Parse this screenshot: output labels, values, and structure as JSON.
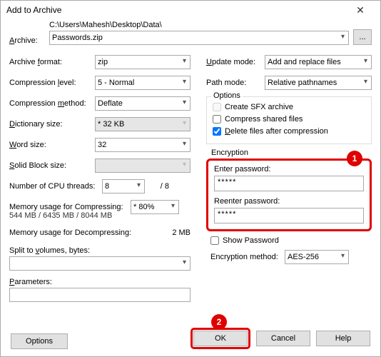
{
  "window": {
    "title": "Add to Archive",
    "close": "✕"
  },
  "top": {
    "archive_lbl_u": "A",
    "archive_lbl_rest": "rchive:",
    "path": "C:\\Users\\Mahesh\\Desktop\\Data\\",
    "filename": "Passwords.zip",
    "browse": "..."
  },
  "left": {
    "format_lbl_rest": "Archive ",
    "format_lbl_u": "f",
    "format_lbl_end": "ormat:",
    "format": "zip",
    "level_lbl": "Compression ",
    "level_lbl_u": "l",
    "level_lbl_end": "evel:",
    "level": "5 - Normal",
    "method_lbl": "Compression ",
    "method_lbl_u": "m",
    "method_lbl_end": "ethod:",
    "method": "Deflate",
    "dict_lbl_u": "D",
    "dict_lbl": "ictionary size:",
    "dict": "* 32 KB",
    "word_lbl_u": "W",
    "word_lbl": "ord size:",
    "word": "32",
    "solid_lbl_u": "S",
    "solid_lbl": "olid Block size:",
    "cpu_lbl": "Number of CPU threads:",
    "cpu": "8",
    "cpu_total": "/ 8",
    "memC_lbl": "Memory usage for Compressing:",
    "memC_sub": "544 MB / 6435 MB / 8044 MB",
    "memC_val": "* 80%",
    "memD_lbl": "Memory usage for Decompressing:",
    "memD_val": "2 MB",
    "split_lbl": "Split to ",
    "split_lbl_u": "v",
    "split_lbl_end": "olumes, bytes:",
    "param_lbl_u": "P",
    "param_lbl": "arameters:",
    "options_btn": "Options"
  },
  "right": {
    "update_lbl_u": "U",
    "update_lbl": "pdate mode:",
    "update": "Add and replace files",
    "path_lbl": "Path mode:",
    "path": "Relative pathnames",
    "options_legend": "Options",
    "sfx": "Create SFX archive",
    "shared": "Compress shared files",
    "delete_lbl_u": "D",
    "delete_lbl": "elete files after compression",
    "enc_legend": "Encryption",
    "enter_pwd": "Enter password:",
    "reenter_pwd": "Reenter password:",
    "mask": "*****",
    "show_pwd": "Show Password",
    "encm_lbl": "Encryption method:",
    "encm": "AES-256"
  },
  "footer": {
    "ok": "OK",
    "cancel": "Cancel",
    "help": "Help"
  },
  "badges": {
    "one": "1",
    "two": "2"
  }
}
